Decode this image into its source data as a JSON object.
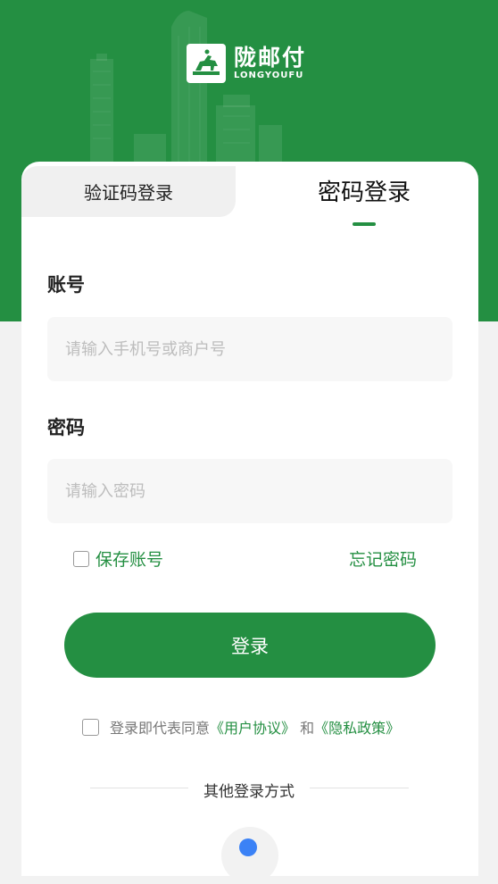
{
  "brand": {
    "name_cn": "陇邮付",
    "name_en": "LONGYOUFU",
    "primary_color": "#248f42",
    "logo_icon": "horse-rider-logo-icon"
  },
  "tabs": [
    {
      "label": "验证码登录",
      "active": false
    },
    {
      "label": "密码登录",
      "active": true
    }
  ],
  "form": {
    "account_label": "账号",
    "account_placeholder": "请输入手机号或商户号",
    "account_value": "",
    "password_label": "密码",
    "password_placeholder": "请输入密码",
    "password_value": ""
  },
  "options": {
    "save_account_label": "保存账号",
    "save_account_checked": false,
    "forgot_password_label": "忘记密码"
  },
  "login_button_label": "登录",
  "agreement": {
    "prefix": "登录即代表同意",
    "user_agreement": "《用户协议》",
    "conjunction": " 和",
    "privacy_policy": "《隐私政策》",
    "checked": false
  },
  "other_login": {
    "label": "其他登录方式",
    "icon": "third-party-login-icon",
    "icon_color": "#3b82f6"
  }
}
